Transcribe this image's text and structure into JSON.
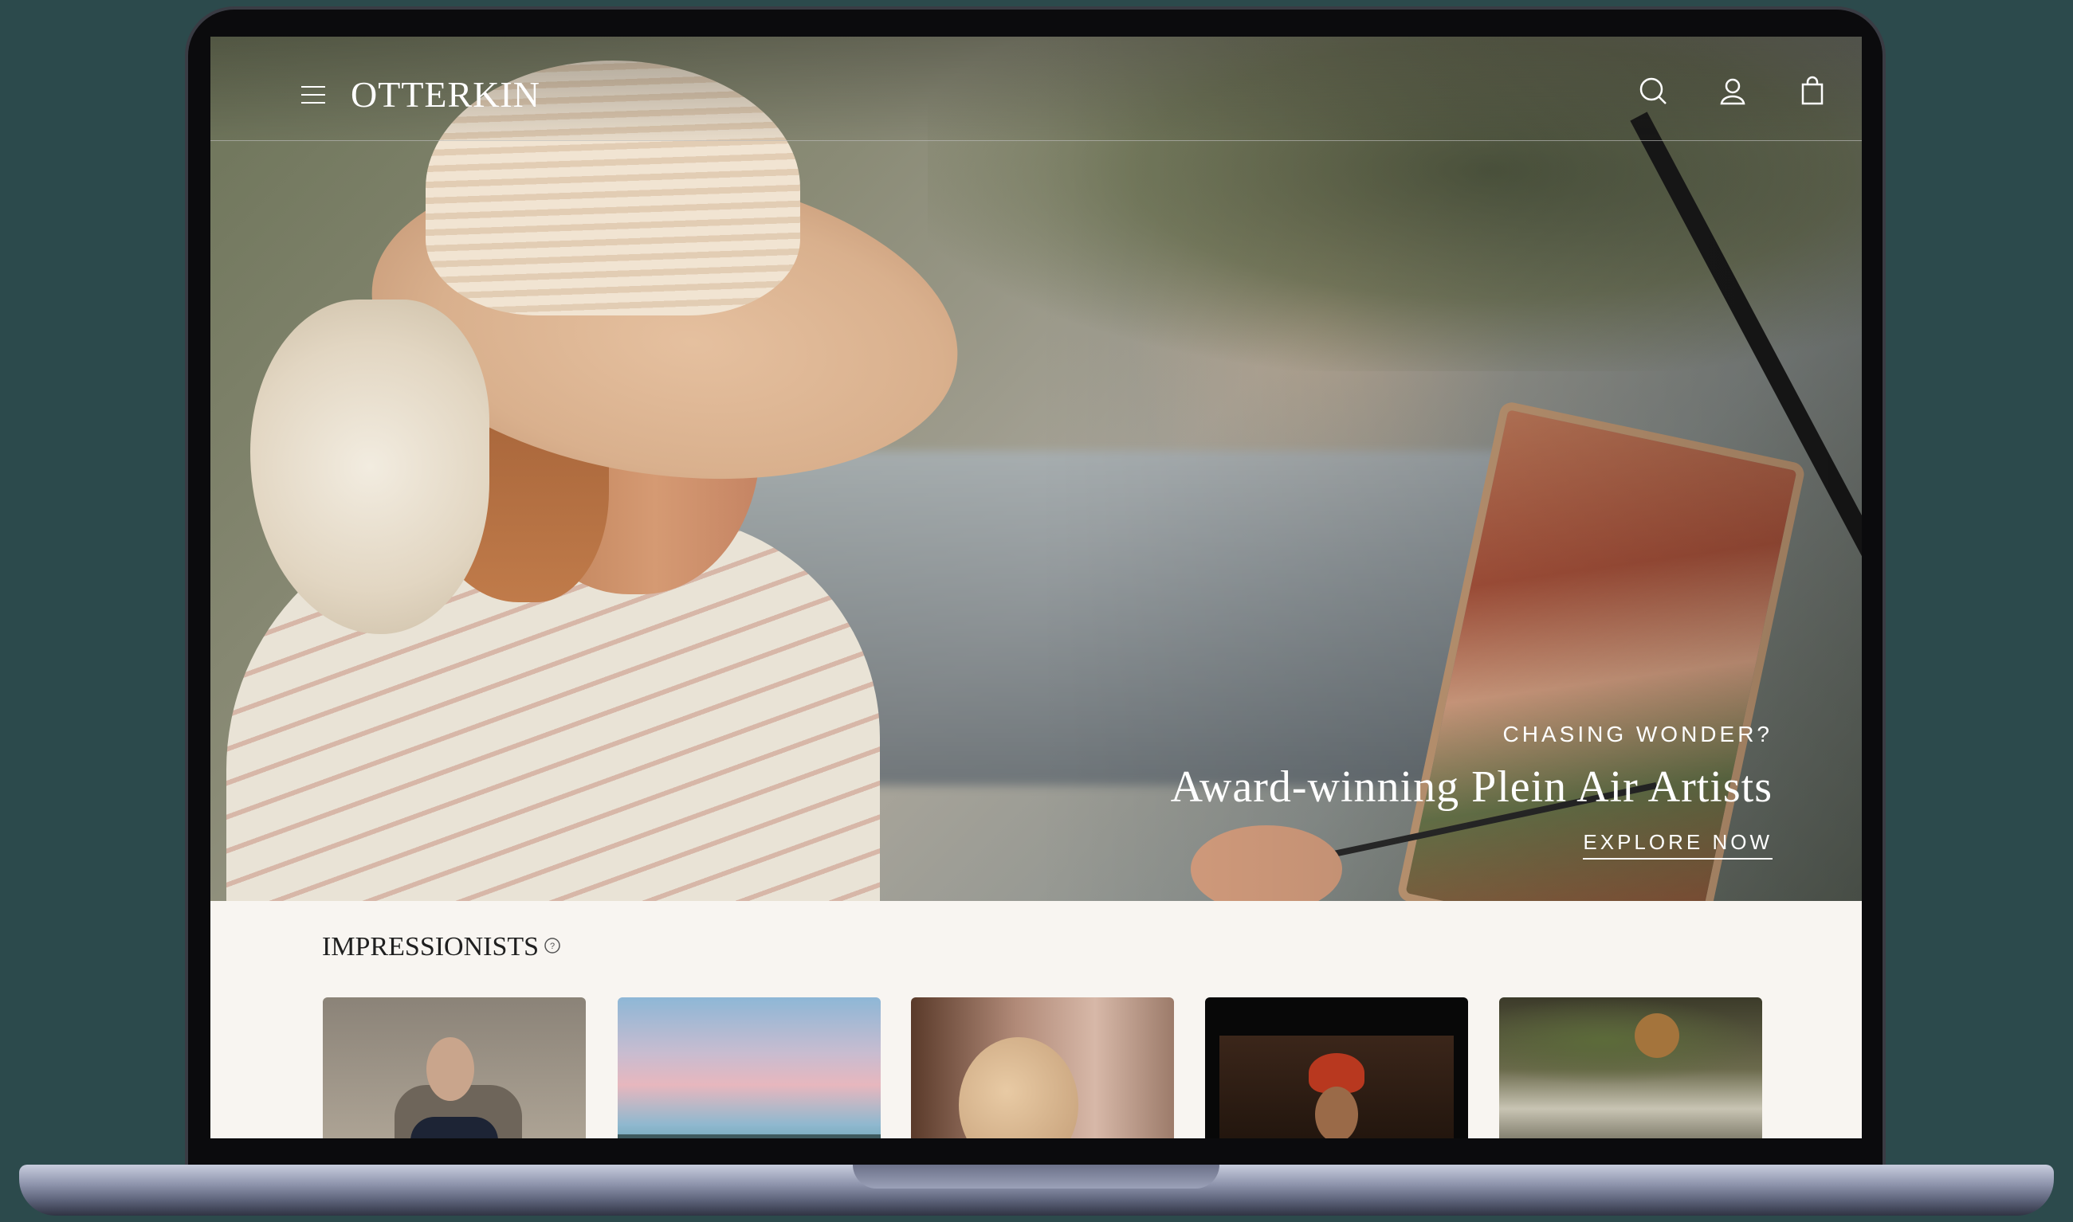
{
  "site": {
    "logo": "OTTERKIN"
  },
  "header": {
    "icons": [
      "menu-icon",
      "search-icon",
      "account-icon",
      "cart-icon"
    ]
  },
  "hero": {
    "kicker": "CHASING WONDER?",
    "headline": "Award-winning Plein Air Artists",
    "cta": "EXPLORE NOW"
  },
  "section": {
    "title": "IMPRESSIONISTS",
    "help_icon": "question-icon"
  },
  "colors": {
    "frame_bg": "#2c4a4c",
    "page_bg": "#f8f5f1",
    "text_dark": "#1f1f1f",
    "text_light": "#ffffff"
  }
}
